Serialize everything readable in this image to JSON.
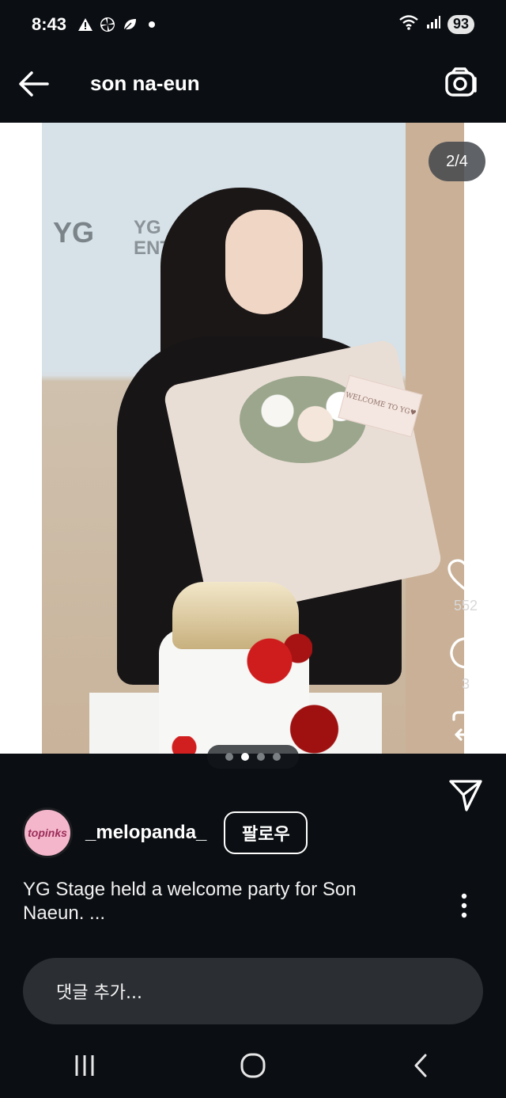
{
  "status_bar": {
    "time": "8:43",
    "battery": "93",
    "icons": [
      "alert-icon",
      "pinwheel-icon",
      "leaf-icon",
      "dot-icon",
      "wifi-icon",
      "signal-icon",
      "battery-icon"
    ]
  },
  "header": {
    "title": "son na-eun",
    "back_icon": "back-arrow-icon",
    "camera_icon": "camera-icon"
  },
  "post": {
    "image_counter": "2/4",
    "carousel": {
      "total": 4,
      "active_index": 1
    },
    "photo_text": {
      "yg_mark": "YG",
      "yg_word": "YG",
      "yg_sub": "ENTERT",
      "card_text": "WELCOME TO YG♥"
    },
    "actions": {
      "like_count": "552",
      "comment_count": "3"
    },
    "author": {
      "username": "_melopanda_",
      "avatar_text": "topinks"
    },
    "follow_label": "팔로우",
    "caption": "YG Stage held a welcome party for Son Naeun. ...",
    "comment_placeholder": "댓글 추가..."
  },
  "nav": {
    "buttons": [
      "recent-apps-icon",
      "home-icon",
      "back-icon"
    ]
  },
  "colors": {
    "background": "#0b0e12",
    "input_bg": "#2b2e33",
    "counter_bg": "#43474b",
    "text": "#ffffff"
  }
}
